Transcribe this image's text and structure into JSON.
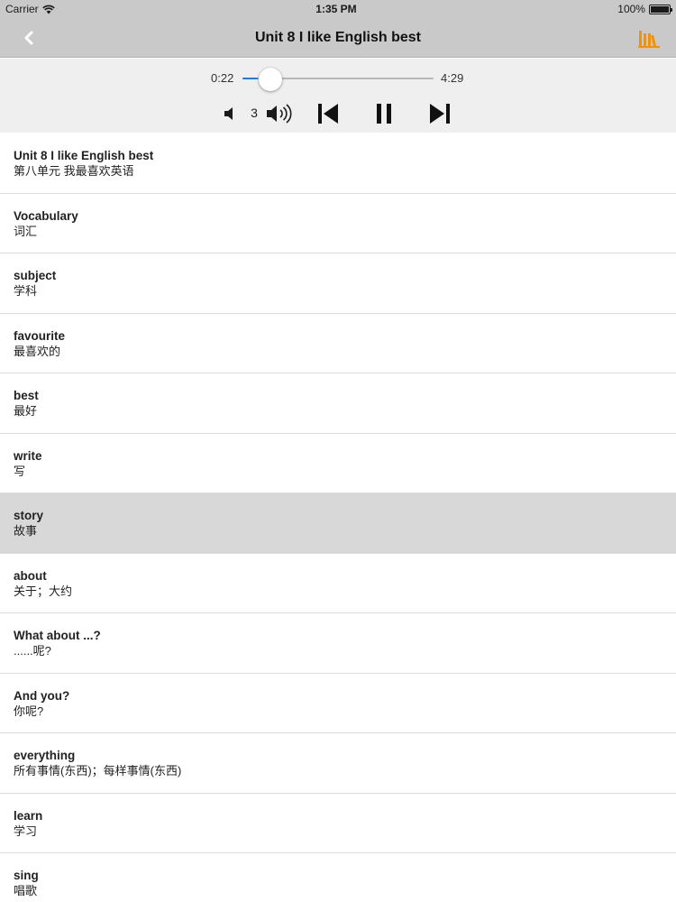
{
  "status_bar": {
    "carrier": "Carrier",
    "wifi_icon": "wifi-icon",
    "time": "1:35 PM",
    "battery": "100%",
    "battery_level": 1.0
  },
  "nav": {
    "title": "Unit 8 I like English best",
    "back_icon": "chevron-left-icon",
    "list_icon": "bookshelf-icon",
    "accent_color": "#f39200"
  },
  "player": {
    "current_time": "0:22",
    "total_time": "4:29",
    "progress": 0.082,
    "volume": "3",
    "accent_color": "#1f7de0"
  },
  "items": [
    {
      "en": "Unit 8 I like English best",
      "cn": "第八单元 我最喜欢英语"
    },
    {
      "en": "Vocabulary",
      "cn": "词汇"
    },
    {
      "en": "subject",
      "cn": "学科"
    },
    {
      "en": "favourite",
      "cn": "最喜欢的"
    },
    {
      "en": "best",
      "cn": "最好"
    },
    {
      "en": "write",
      "cn": "写"
    },
    {
      "en": "story",
      "cn": "故事",
      "selected": true
    },
    {
      "en": "about",
      "cn": "关于；大约"
    },
    {
      "en": "What about ...?",
      "cn": "......呢?"
    },
    {
      "en": "And you?",
      "cn": "你呢?"
    },
    {
      "en": "everything",
      "cn": "所有事情(东西)；每样事情(东西)"
    },
    {
      "en": "learn",
      "cn": "学习"
    },
    {
      "en": "sing",
      "cn": "唱歌"
    }
  ]
}
